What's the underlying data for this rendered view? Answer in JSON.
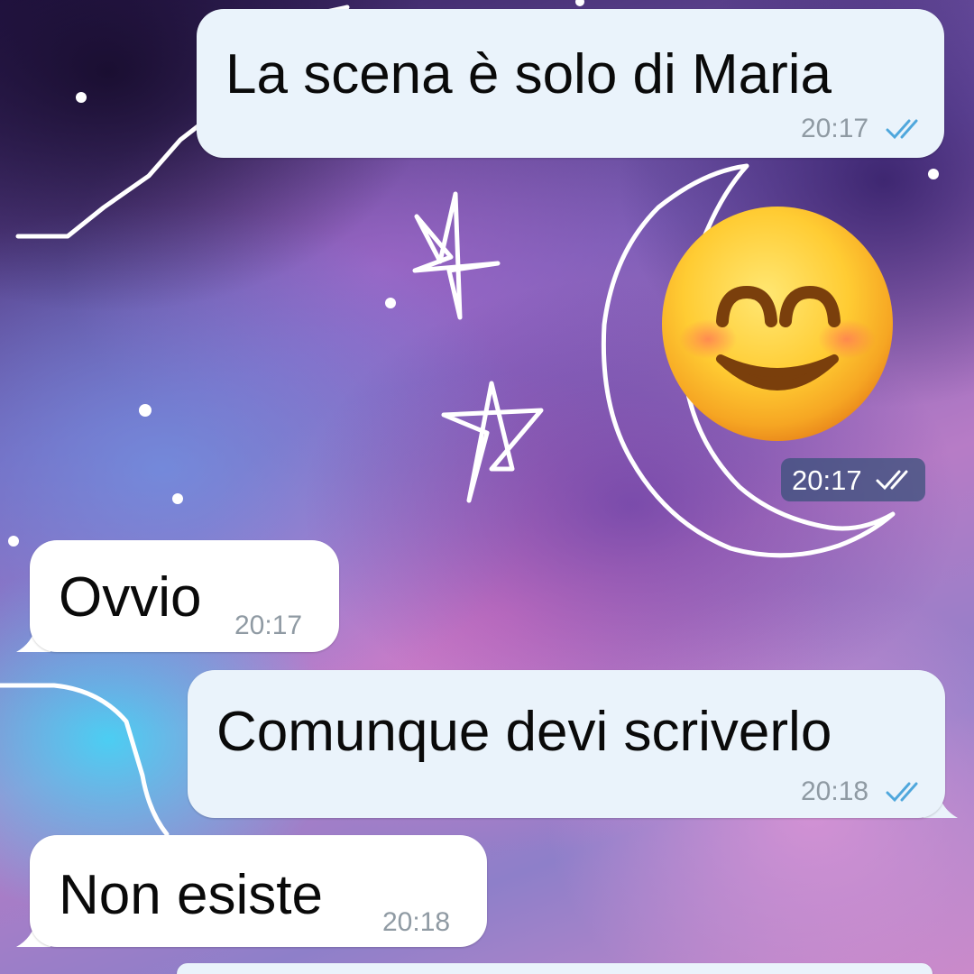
{
  "chat": {
    "messages": [
      {
        "direction": "outgoing",
        "type": "text",
        "text": "La scena è solo di Maria",
        "time": "20:17",
        "status_icon": "double-check-read"
      },
      {
        "direction": "outgoing",
        "type": "emoji-sticker",
        "emoji": "😊",
        "emoji_name": "smiling-face-with-smiling-eyes",
        "time": "20:17",
        "status_icon": "double-check"
      },
      {
        "direction": "incoming",
        "type": "text",
        "text": "Ovvio",
        "time": "20:17"
      },
      {
        "direction": "outgoing",
        "type": "text",
        "text": "Comunque devi scriverlo",
        "time": "20:18",
        "status_icon": "double-check-read"
      },
      {
        "direction": "incoming",
        "type": "text",
        "text": "Non esiste",
        "time": "20:18"
      }
    ]
  },
  "colors": {
    "outgoing_bubble": "#eaf3fb",
    "incoming_bubble": "#ffffff",
    "read_ticks": "#4fa7dc",
    "timestamp": "#8f9aa3"
  }
}
